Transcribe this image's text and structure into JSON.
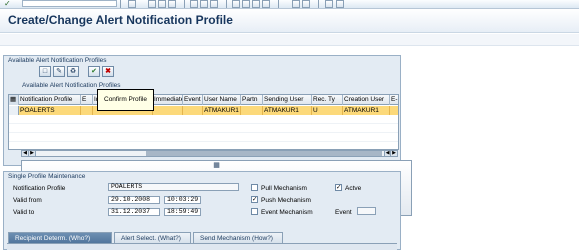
{
  "window": {
    "title": "Create/Change Alert Notification Profile"
  },
  "toolbar_icons": [
    "enter-icon",
    "save-icon",
    "back-icon",
    "exit-icon",
    "cancel-icon",
    "print-icon",
    "find-icon",
    "find-next-icon",
    "first-page-icon",
    "previous-page-icon",
    "next-page-icon",
    "last-page-icon",
    "create-session-icon",
    "shortcut-icon",
    "help-icon",
    "layout-icon"
  ],
  "profiles_panel": {
    "title": "Available Alert Notification Profiles",
    "table_caption": "Available Alert Notification Profiles",
    "toolbar_icons": [
      "details-icon",
      "create-icon",
      "change-icon",
      "delete-icon",
      "confirm-icon",
      "cancel-icon"
    ],
    "columns": [
      "Notification Profile",
      "E",
      "Id",
      "Immediate",
      "Event",
      "User Name",
      "Partn",
      "Sending User",
      "Rec. Ty",
      "Creation User",
      "E-M"
    ],
    "rows": [
      {
        "profile": "POALERTS",
        "e": "",
        "id": "",
        "immediate": "",
        "event": "",
        "user_name": "ATMAKUR1",
        "partner": "",
        "sending_user": "ATMAKUR1",
        "rec_type": "U",
        "creation_user": "ATMAKUR1",
        "email": ""
      }
    ],
    "tooltip": "Confirm Profile"
  },
  "maintenance": {
    "title": "Single Profile Maintenance",
    "notification_profile_label": "Notification Profile",
    "notification_profile_value": "POALERTS",
    "valid_from_label": "Valid from",
    "valid_from_date": "29.10.2008",
    "valid_from_time": "10:03:29",
    "valid_to_label": "Valid to",
    "valid_to_date": "31.12.2037",
    "valid_to_time": "18:59:49",
    "pull_label": "Pull Mechanism",
    "pull_checked": false,
    "push_label": "Push Mechanism",
    "push_checked": true,
    "event_mech_label": "Event Mechanism",
    "event_mech_checked": false,
    "active_label": "Actve",
    "active_checked": true,
    "event_label": "Event",
    "event_value": ""
  },
  "tabs": [
    {
      "label": "Recipient Determ. (Who?)",
      "active": true
    },
    {
      "label": "Alert Select. (What?)",
      "active": false
    },
    {
      "label": "Send Mechanism (How?)",
      "active": false
    }
  ]
}
